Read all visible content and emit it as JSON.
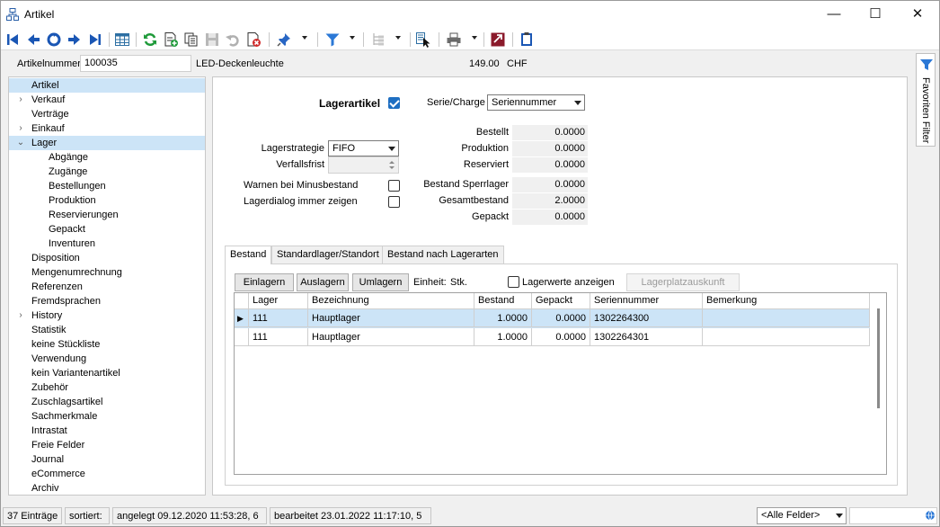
{
  "window": {
    "title": "Artikel",
    "minimize": "—",
    "maximize": "☐",
    "close": "✕"
  },
  "toolbar": {
    "buttons": [
      "first-record-icon",
      "prev-record-icon",
      "refresh-record-icon",
      "next-record-icon",
      "last-record-icon",
      "table-view-icon",
      "reload-icon",
      "new-record-icon",
      "copy-record-icon",
      "save-icon",
      "undo-icon",
      "delete-icon",
      "pin-icon",
      "filter-icon",
      "tree-icon",
      "select-pointer-icon",
      "print-icon",
      "export-icon",
      "clipboard-icon"
    ],
    "colors": {
      "nav": "#1a56b4",
      "green": "#1f9a3a",
      "red": "#d02b2b",
      "teal": "#2d6fa3"
    }
  },
  "header": {
    "artikelnummer_label": "Artikelnummer",
    "artikelnummer_value": "100035",
    "bezeichnung": "LED-Deckenleuchte",
    "preis": "149.00",
    "waehrung": "CHF"
  },
  "nav": [
    {
      "label": "Artikel",
      "level": 0,
      "expander": "",
      "selected": true
    },
    {
      "label": "Verkauf",
      "level": 0,
      "expander": "›"
    },
    {
      "label": "Verträge",
      "level": 0,
      "expander": ""
    },
    {
      "label": "Einkauf",
      "level": 0,
      "expander": "›"
    },
    {
      "label": "Lager",
      "level": 0,
      "expander": "⌄",
      "selected": true
    },
    {
      "label": "Abgänge",
      "level": 1
    },
    {
      "label": "Zugänge",
      "level": 1
    },
    {
      "label": "Bestellungen",
      "level": 1
    },
    {
      "label": "Produktion",
      "level": 1
    },
    {
      "label": "Reservierungen",
      "level": 1
    },
    {
      "label": "Gepackt",
      "level": 1
    },
    {
      "label": "Inventuren",
      "level": 1
    },
    {
      "label": "Disposition",
      "level": 0
    },
    {
      "label": "Mengenumrechnung",
      "level": 0
    },
    {
      "label": "Referenzen",
      "level": 0
    },
    {
      "label": "Fremdsprachen",
      "level": 0
    },
    {
      "label": "History",
      "level": 0,
      "expander": "›"
    },
    {
      "label": "Statistik",
      "level": 0
    },
    {
      "label": "keine Stückliste",
      "level": 0
    },
    {
      "label": "Verwendung",
      "level": 0
    },
    {
      "label": "kein Variantenartikel",
      "level": 0
    },
    {
      "label": "Zubehör",
      "level": 0
    },
    {
      "label": "Zuschlagsartikel",
      "level": 0
    },
    {
      "label": "Sachmerkmale",
      "level": 0
    },
    {
      "label": "Intrastat",
      "level": 0
    },
    {
      "label": "Freie Felder",
      "level": 0
    },
    {
      "label": "Journal",
      "level": 0
    },
    {
      "label": "eCommerce",
      "level": 0
    },
    {
      "label": "Archiv",
      "level": 0
    }
  ],
  "form": {
    "lagerartikel_label": "Lagerartikel",
    "lagerartikel_checked": true,
    "serie_charge_label": "Serie/Charge",
    "serie_charge_value": "Seriennummer",
    "lagerstrategie_label": "Lagerstrategie",
    "lagerstrategie_value": "FIFO",
    "verfallsfrist_label": "Verfallsfrist",
    "verfallsfrist_value": "",
    "warnen_label": "Warnen bei Minusbestand",
    "warnen_checked": false,
    "lagerdialog_label": "Lagerdialog immer zeigen",
    "lagerdialog_checked": false,
    "bestellt_label": "Bestellt",
    "bestellt_value": "0.0000",
    "produktion_label": "Produktion",
    "produktion_value": "0.0000",
    "reserviert_label": "Reserviert",
    "reserviert_value": "0.0000",
    "sperrlager_label": "Bestand Sperrlager",
    "sperrlager_value": "0.0000",
    "gesamt_label": "Gesamtbestand",
    "gesamt_value": "2.0000",
    "gepackt_label": "Gepackt",
    "gepackt_value": "0.0000"
  },
  "tabs": [
    "Bestand",
    "Standardlager/Standort",
    "Bestand nach Lagerarten"
  ],
  "bestand": {
    "einlagern": "Einlagern",
    "auslagern": "Auslagern",
    "umlagern": "Umlagern",
    "einheit_label": "Einheit:",
    "einheit_value": "Stk.",
    "lagerwerte_label": "Lagerwerte anzeigen",
    "lagerplatz_button": "Lagerplatzauskunft",
    "columns": [
      "Lager",
      "Bezeichnung",
      "Bestand",
      "Gepackt",
      "Seriennummer",
      "Bemerkung"
    ],
    "rows": [
      [
        "111",
        "Hauptlager",
        "1.0000",
        "0.0000",
        "1302264300",
        ""
      ],
      [
        "111",
        "Hauptlager",
        "1.0000",
        "0.0000",
        "1302264301",
        ""
      ]
    ],
    "current_row_marker": "▶"
  },
  "sidebar_right": {
    "label": "Favoriten Filter"
  },
  "status": {
    "count": "37 Einträge",
    "sortiert": "sortiert:",
    "angelegt": "angelegt 09.12.2020 11:53:28,  6",
    "bearbeitet": "bearbeitet 23.01.2022 11:17:10,  5",
    "filter_select": "<Alle Felder>",
    "search_value": ""
  }
}
